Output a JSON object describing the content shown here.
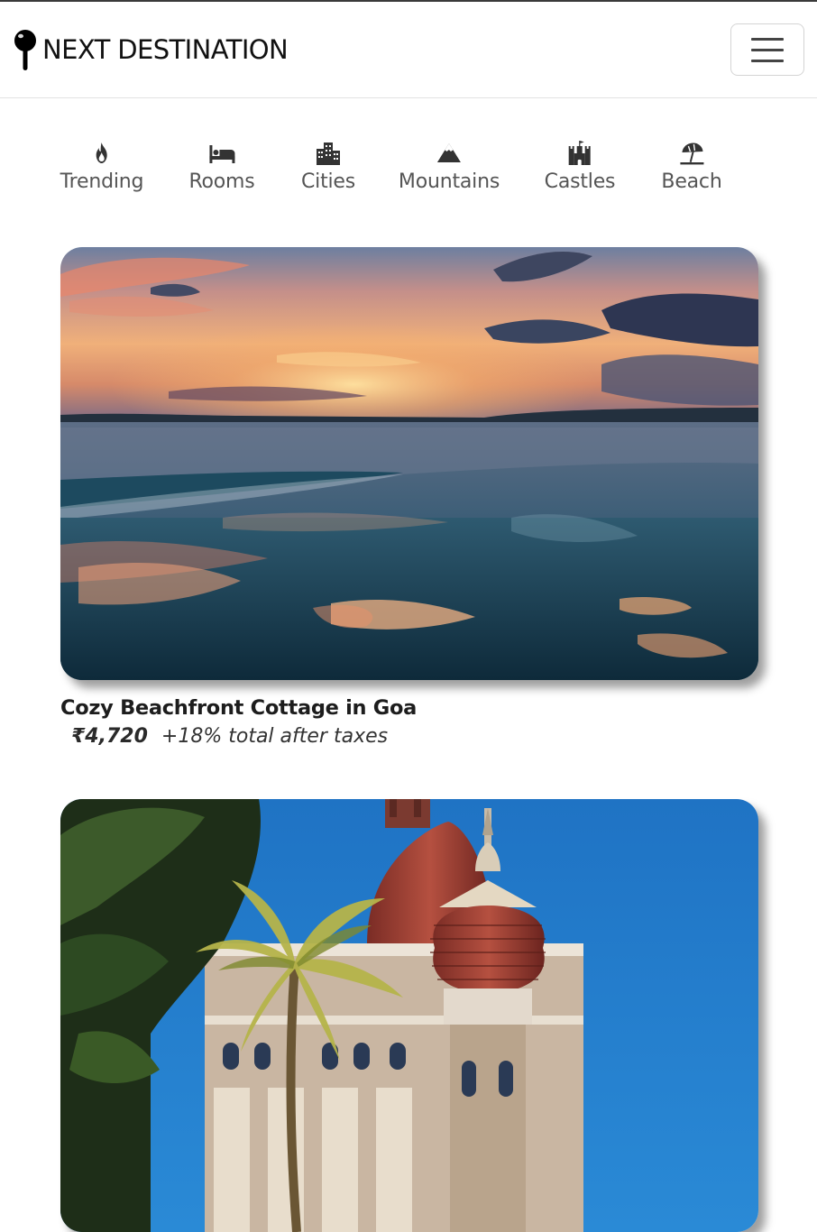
{
  "brand": {
    "name": "NEXT DESTINATION",
    "icon": "map-pin-icon"
  },
  "menu": {
    "icon": "hamburger-menu-icon"
  },
  "filters": [
    {
      "label": "Trending",
      "icon": "fire-icon"
    },
    {
      "label": "Rooms",
      "icon": "bed-icon"
    },
    {
      "label": "Cities",
      "icon": "city-icon"
    },
    {
      "label": "Mountains",
      "icon": "mountain-icon"
    },
    {
      "label": "Castles",
      "icon": "castle-icon"
    },
    {
      "label": "Beach",
      "icon": "umbrella-beach-icon"
    }
  ],
  "listings": [
    {
      "title": "Cozy Beachfront Cottage in Goa",
      "price": "₹4,720",
      "tax_note": "+18% total after taxes"
    },
    {
      "title": "",
      "price": "",
      "tax_note": ""
    }
  ],
  "colors": {
    "text": "#222222",
    "muted": "#555555",
    "border": "#e2e2e2"
  }
}
